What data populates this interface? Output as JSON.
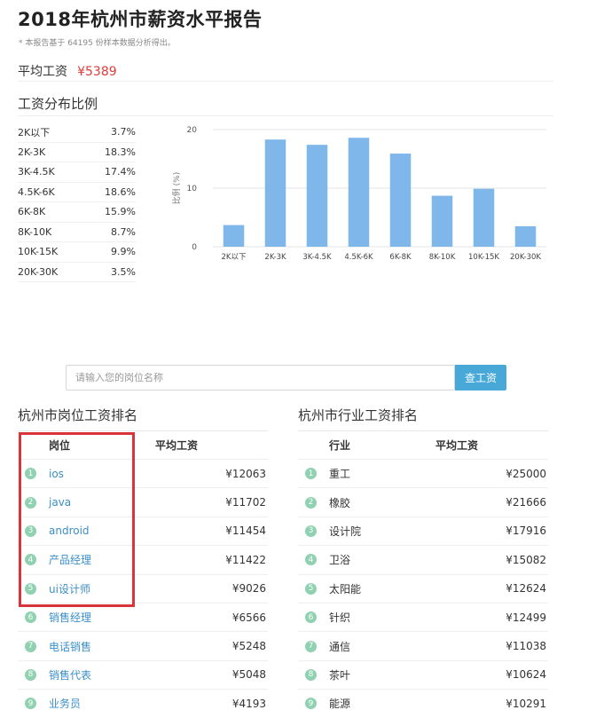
{
  "header": {
    "title": "2018年杭州市薪资水平报告",
    "note": "* 本报告基于 64195 份样本数据分析得出。"
  },
  "average": {
    "label": "平均工资",
    "value": "¥5389"
  },
  "distribution": {
    "title": "工资分布比例",
    "rows": [
      {
        "range": "2K以下",
        "pct": "3.7%"
      },
      {
        "range": "2K-3K",
        "pct": "18.3%"
      },
      {
        "range": "3K-4.5K",
        "pct": "17.4%"
      },
      {
        "range": "4.5K-6K",
        "pct": "18.6%"
      },
      {
        "range": "6K-8K",
        "pct": "15.9%"
      },
      {
        "range": "8K-10K",
        "pct": "8.7%"
      },
      {
        "range": "10K-15K",
        "pct": "9.9%"
      },
      {
        "range": "20K-30K",
        "pct": "3.5%"
      }
    ]
  },
  "chart_data": {
    "type": "bar",
    "categories": [
      "2K以下",
      "2K-3K",
      "3K-4.5K",
      "4.5K-6K",
      "6K-8K",
      "8K-10K",
      "10K-15K",
      "20K-30K"
    ],
    "values": [
      3.7,
      18.3,
      17.4,
      18.6,
      15.9,
      8.7,
      9.9,
      3.5
    ],
    "ylabel": "比例 (%)",
    "ylim": [
      0,
      20
    ],
    "yticks": [
      0,
      10,
      20
    ],
    "bar_color": "#7fb7ea",
    "grid": true
  },
  "search": {
    "placeholder": "请输入您的岗位名称",
    "button": "查工资"
  },
  "job_ranking": {
    "title": "杭州市岗位工资排名",
    "col_name": "岗位",
    "col_salary": "平均工资",
    "rows": [
      {
        "rank": "1",
        "name": "ios",
        "salary": "¥12063"
      },
      {
        "rank": "2",
        "name": "java",
        "salary": "¥11702"
      },
      {
        "rank": "3",
        "name": "android",
        "salary": "¥11454"
      },
      {
        "rank": "4",
        "name": "产品经理",
        "salary": "¥11422"
      },
      {
        "rank": "5",
        "name": "ui设计师",
        "salary": "¥9026"
      },
      {
        "rank": "6",
        "name": "销售经理",
        "salary": "¥6566"
      },
      {
        "rank": "7",
        "name": "电话销售",
        "salary": "¥5248"
      },
      {
        "rank": "8",
        "name": "销售代表",
        "salary": "¥5048"
      },
      {
        "rank": "9",
        "name": "业务员",
        "salary": "¥4193"
      }
    ]
  },
  "industry_ranking": {
    "title": "杭州市行业工资排名",
    "col_name": "行业",
    "col_salary": "平均工资",
    "rows": [
      {
        "rank": "1",
        "name": "重工",
        "salary": "¥25000"
      },
      {
        "rank": "2",
        "name": "橡胶",
        "salary": "¥21666"
      },
      {
        "rank": "3",
        "name": "设计院",
        "salary": "¥17916"
      },
      {
        "rank": "4",
        "name": "卫浴",
        "salary": "¥15082"
      },
      {
        "rank": "5",
        "name": "太阳能",
        "salary": "¥12624"
      },
      {
        "rank": "6",
        "name": "针织",
        "salary": "¥12499"
      },
      {
        "rank": "7",
        "name": "通信",
        "salary": "¥11038"
      },
      {
        "rank": "8",
        "name": "茶叶",
        "salary": "¥10624"
      },
      {
        "rank": "9",
        "name": "能源",
        "salary": "¥10291"
      }
    ]
  },
  "colors": {
    "accent": "#48a8d8",
    "price": "#e03a3a",
    "badge": "#8fd1b0",
    "link": "#3b8fc9",
    "highlight": "#d9343a"
  }
}
